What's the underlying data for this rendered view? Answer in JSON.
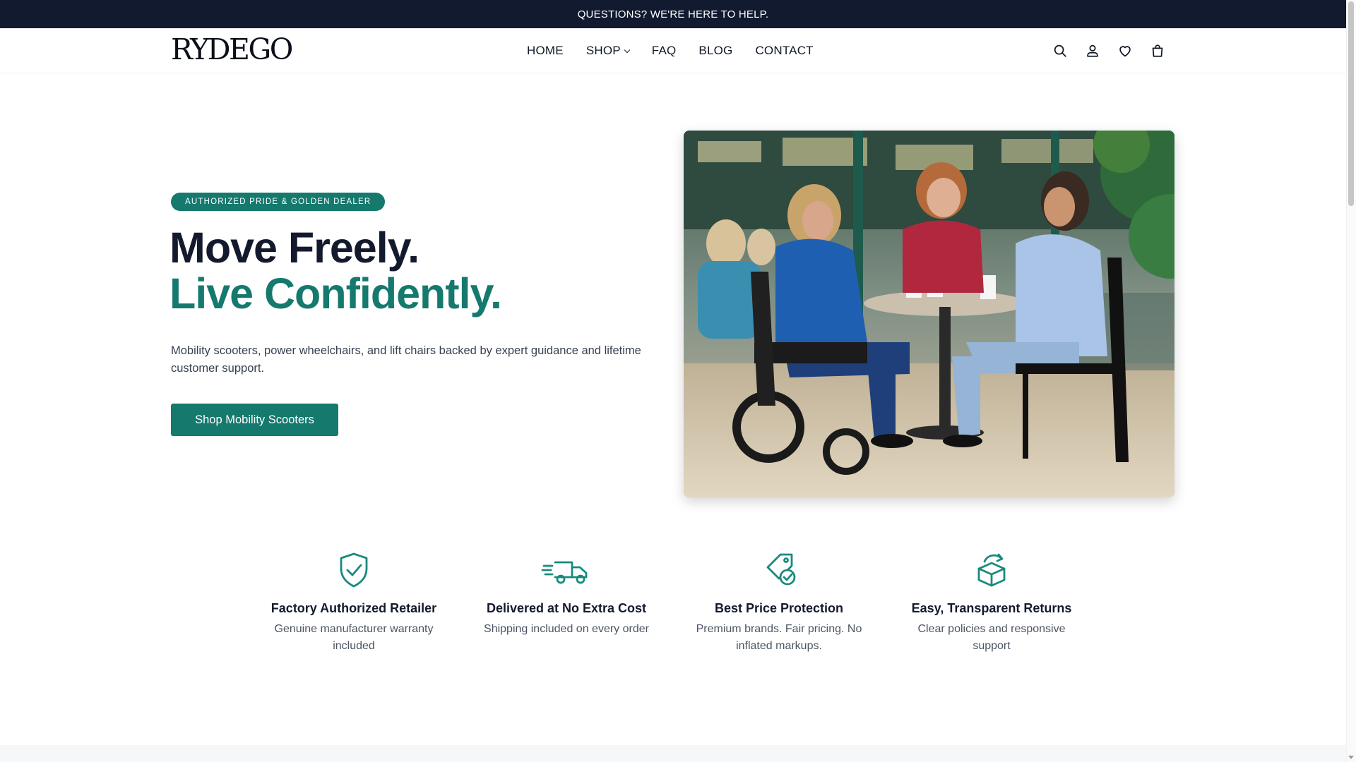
{
  "announcement": {
    "text": "QUESTIONS? WE'RE HERE TO HELP."
  },
  "header": {
    "logo": "RYDEGO",
    "nav": [
      {
        "label": "HOME"
      },
      {
        "label": "SHOP",
        "has_dropdown": true
      },
      {
        "label": "FAQ"
      },
      {
        "label": "BLOG"
      },
      {
        "label": "CONTACT"
      }
    ],
    "tools": [
      "search-icon",
      "account-icon",
      "wishlist-heart-icon",
      "cart-bag-icon"
    ]
  },
  "hero": {
    "badge": "AUTHORIZED PRIDE & GOLDEN DEALER",
    "headline_line1": "Move Freely.",
    "headline_line2": "Live Confidently.",
    "lead": "Mobility scooters, power wheelchairs, and lift chairs backed by expert guidance and lifetime customer support.",
    "cta_label": "Shop Mobility Scooters",
    "image_desc": "hero-photo-women-at-cafe-with-power-wheelchair"
  },
  "features": [
    {
      "icon": "shield-check-icon",
      "title": "Factory Authorized Retailer",
      "text": "Genuine manufacturer warranty included"
    },
    {
      "icon": "delivery-truck-icon",
      "title": "Delivered at No Extra Cost",
      "text": "Shipping included on every order"
    },
    {
      "icon": "price-tag-check-icon",
      "title": "Best Price Protection",
      "text": "Premium brands. Fair pricing. No inflated markups."
    },
    {
      "icon": "return-box-icon",
      "title": "Easy, Transparent Returns",
      "text": "Clear policies and responsive support"
    }
  ],
  "colors": {
    "accent": "#15796e",
    "navy": "#141a2e",
    "announcement_bg": "#111a2e"
  }
}
